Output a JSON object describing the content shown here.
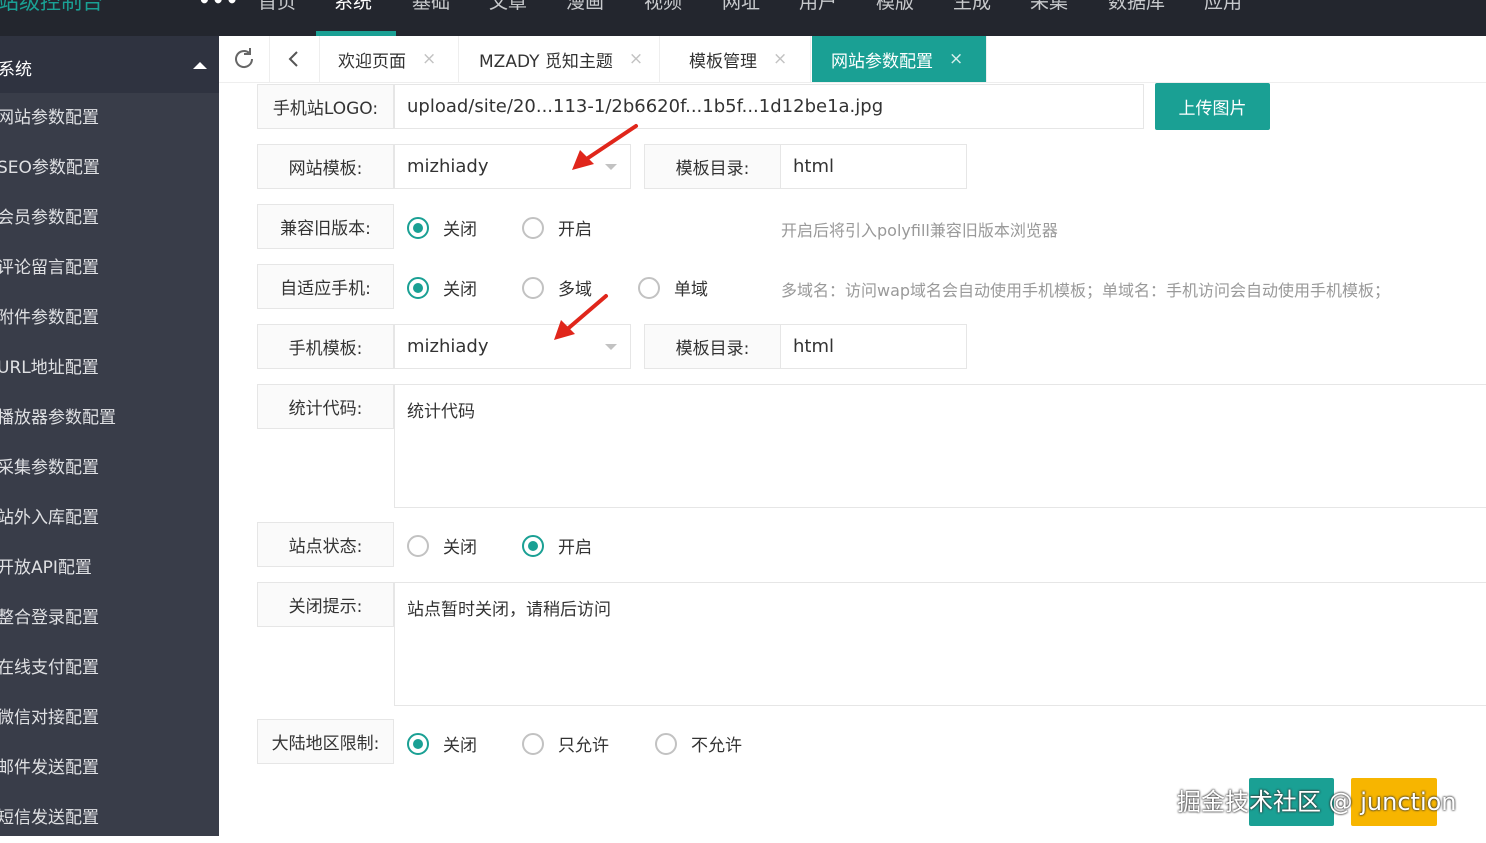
{
  "app": {
    "brand": "站级控制台",
    "more": "•••",
    "topnav": [
      "首页",
      "系统",
      "基础",
      "文章",
      "漫画",
      "视频",
      "网址",
      "用户",
      "模版",
      "生成",
      "采集",
      "数据库",
      "应用"
    ],
    "active_topnav": "系统"
  },
  "sidebar": {
    "header": "系统",
    "items": [
      "网站参数配置",
      "SEO参数配置",
      "会员参数配置",
      "评论留言配置",
      "附件参数配置",
      "URL地址配置",
      "播放器参数配置",
      "采集参数配置",
      "站外入库配置",
      "开放API配置",
      "整合登录配置",
      "在线支付配置",
      "微信对接配置",
      "邮件发送配置",
      "短信发送配置"
    ]
  },
  "tabs": {
    "items": [
      "欢迎页面",
      "MZADY 觅知主题",
      "模板管理",
      "网站参数配置"
    ],
    "active": "网站参数配置",
    "close": "×"
  },
  "form": {
    "mobile_logo": {
      "label": "手机站LOGO:",
      "value": "upload/site/20...113-1/2b6620f...1b5f...1d12be1a.jpg",
      "upload_button": "上传图片"
    },
    "site_template": {
      "label": "网站模板:",
      "value": "mizhiady",
      "dir_label": "模板目录:",
      "dir_value": "html"
    },
    "compat": {
      "label": "兼容旧版本:",
      "options": [
        "关闭",
        "开启"
      ],
      "selected": "关闭",
      "hint": "开启后将引入polyfill兼容旧版本浏览器"
    },
    "adaptive": {
      "label": "自适应手机:",
      "options": [
        "关闭",
        "多域",
        "单域"
      ],
      "selected": "关闭",
      "hint": "多域名：访问wap域名会自动使用手机模板；单域名：手机访问会自动使用手机模板；"
    },
    "mobile_template": {
      "label": "手机模板:",
      "value": "mizhiady",
      "dir_label": "模板目录:",
      "dir_value": "html"
    },
    "stats": {
      "label": "统计代码:",
      "value": "统计代码"
    },
    "site_status": {
      "label": "站点状态:",
      "options": [
        "关闭",
        "开启"
      ],
      "selected": "开启"
    },
    "close_tip": {
      "label": "关闭提示:",
      "value": "站点暂时关闭，请稍后访问"
    },
    "region": {
      "label": "大陆地区限制:",
      "options": [
        "关闭",
        "只允许",
        "不允许"
      ],
      "selected": "关闭"
    }
  },
  "watermark": "掘金技术社区 @ junction",
  "colors": {
    "accent": "#1aa094",
    "topbar": "#23262e",
    "sidebar": "#393d49",
    "arrow": "#e0261b",
    "float_button_yellow": "#f7b500"
  }
}
